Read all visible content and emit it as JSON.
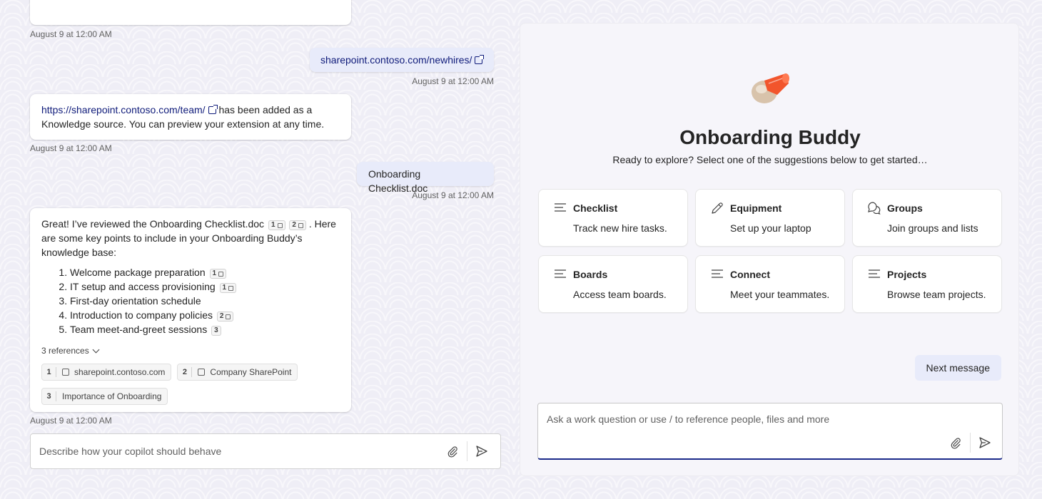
{
  "chat": {
    "messages": [
      {
        "timestamp": "August 9 at 12:00 AM"
      },
      {
        "role": "user",
        "link_text": "sharepoint.contoso.com/newhires/",
        "timestamp": "August 9 at 12:00 AM"
      },
      {
        "role": "bot",
        "link_text": "https://sharepoint.contoso.com/team/",
        "text": "has been added as a Knowledge source. You can preview your extension at any time.",
        "timestamp": "August 9 at 12:00 AM"
      },
      {
        "role": "user",
        "text": "Onboarding Checklist.doc",
        "timestamp": "August 9 at 12:00 AM"
      },
      {
        "role": "bot",
        "intro_a": "Great! I’ve reviewed the Onboarding Checklist.doc",
        "intro_cites": [
          "1",
          "2"
        ],
        "intro_b": ". Here are some key points to include in your Onboarding Buddy’s knowledge base:",
        "items": [
          {
            "text": "Welcome package preparation",
            "cite": "1",
            "linked": true
          },
          {
            "text": "IT setup and access provisioning",
            "cite": "1",
            "linked": true
          },
          {
            "text": "First-day orientation schedule",
            "cite": "",
            "linked": false
          },
          {
            "text": "Introduction to company policies",
            "cite": "2",
            "linked": true
          },
          {
            "text": "Team meet-and-greet sessions",
            "cite": "3",
            "linked": false
          }
        ],
        "references_label": "3 references",
        "references": [
          {
            "num": "1",
            "label": "sharepoint.contoso.com",
            "external": true
          },
          {
            "num": "2",
            "label": "Company SharePoint",
            "external": true
          },
          {
            "num": "3",
            "label": "Importance of Onboarding",
            "external": false
          }
        ],
        "timestamp": "August 9 at 12:00 AM"
      }
    ],
    "input_placeholder": "Describe how your copilot should behave"
  },
  "preview": {
    "title": "Onboarding Buddy",
    "subtitle": "Ready to explore? Select one of the suggestions below to get started…",
    "cards": [
      {
        "title": "Checklist",
        "desc": "Track new hire tasks.",
        "icon": "text-lines-icon"
      },
      {
        "title": "Equipment",
        "desc": "Set up your laptop",
        "icon": "pencil-icon"
      },
      {
        "title": "Groups",
        "desc": "Join groups and lists",
        "icon": "chat-bubbles-icon"
      },
      {
        "title": "Boards",
        "desc": "Access team boards.",
        "icon": "text-lines-icon"
      },
      {
        "title": "Connect",
        "desc": "Meet your teammates.",
        "icon": "text-lines-icon"
      },
      {
        "title": "Projects",
        "desc": "Browse team projects.",
        "icon": "text-lines-icon"
      }
    ],
    "next_message_label": "Next message",
    "compose_placeholder": "Ask a work question or use / to reference people, files and more"
  },
  "colors": {
    "accent": "#1b2a8a",
    "user_bubble": "#e8ebfa",
    "link": "#0f1b7a",
    "logo_orange": "#f2552c",
    "logo_beige": "#d8c3ab"
  }
}
